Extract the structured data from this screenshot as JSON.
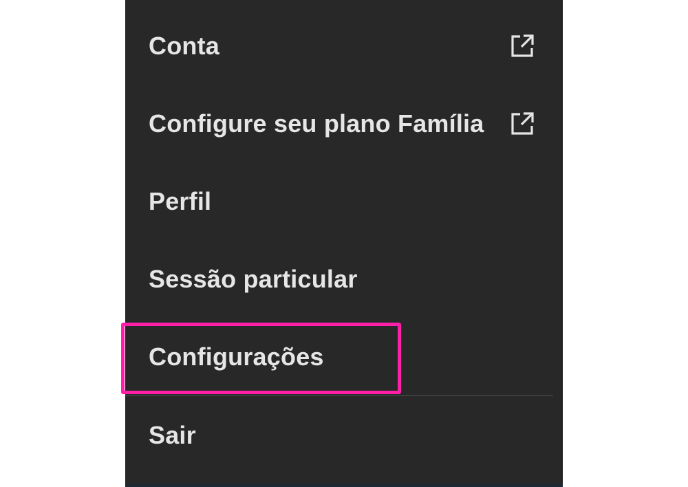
{
  "menu": {
    "items": [
      {
        "label": "Conta",
        "icon": "external-link-icon"
      },
      {
        "label": "Configure seu plano Família",
        "icon": "external-link-icon"
      },
      {
        "label": "Perfil"
      },
      {
        "label": "Sessão particular"
      },
      {
        "label": "Configurações",
        "highlighted": true
      },
      {
        "label": "Sair"
      }
    ]
  },
  "colors": {
    "menu_background": "#282828",
    "text": "#e6e6e6",
    "highlight_border": "#ff1fa8",
    "divider": "#3e3e3e"
  }
}
